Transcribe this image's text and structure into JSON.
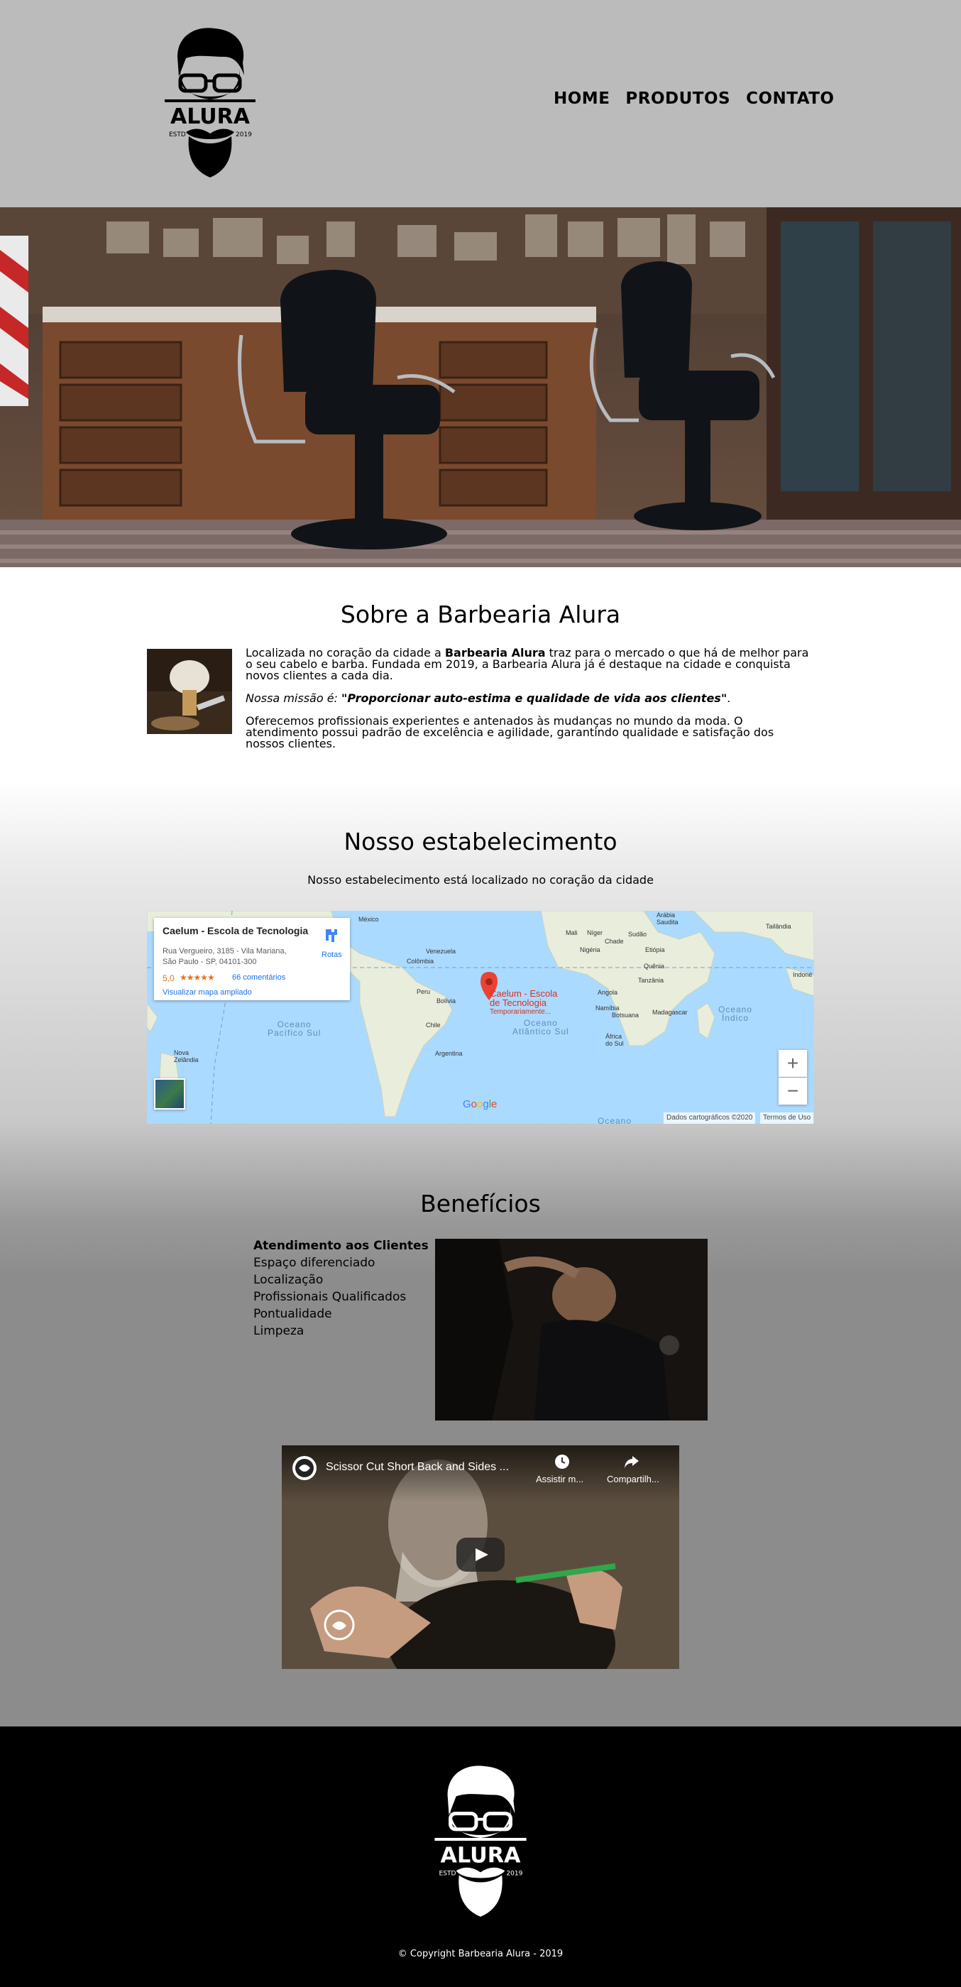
{
  "header": {
    "logo": {
      "brand": "ALURA",
      "estd": "ESTD",
      "year": "2019"
    },
    "nav": [
      "HOME",
      "PRODUTOS",
      "CONTATO"
    ]
  },
  "about": {
    "title": "Sobre a Barbearia Alura",
    "p1_before": "Localizada no coração da cidade a ",
    "p1_bold": "Barbearia Alura",
    "p1_after": " traz para o mercado o que há de melhor para o seu cabelo e barba. Fundada em 2019, a Barbearia Alura já é destaque na cidade e conquista novos clientes a cada dia.",
    "mission_label": "Nossa missão é: ",
    "mission_text": "\"Proporcionar auto-estima e qualidade de vida aos clientes\"",
    "mission_end": ".",
    "p3": "Oferecemos profissionais experientes e antenados às mudanças no mundo da moda. O atendimento possui padrão de excelência e agilidade, garantindo qualidade e satisfação dos nossos clientes."
  },
  "establishment": {
    "title": "Nosso estabelecimento",
    "subtitle": "Nosso estabelecimento está localizado no coração da cidade",
    "map": {
      "place_name": "Caelum - Escola de Tecnologia",
      "address_line1": "Rua Vergueiro, 3185 - Vila Mariana,",
      "address_line2": "São Paulo - SP, 04101-300",
      "rating": "5,0",
      "stars": "★★★★★",
      "reviews": "66 comentários",
      "larger_map": "Visualizar mapa ampliado",
      "directions": "Rotas",
      "pin_line1": "Caelum - Escola",
      "pin_line2": "de Tecnologia",
      "pin_status": "Temporariamente...",
      "zoom_in": "+",
      "zoom_out": "−",
      "attribution": "Dados cartográficos ©2020",
      "terms": "Termos de Uso",
      "google": [
        "G",
        "o",
        "o",
        "g",
        "l",
        "e"
      ],
      "google_colors": [
        "#4285f4",
        "#ea4335",
        "#fbbc05",
        "#4285f4",
        "#34a853",
        "#ea4335"
      ],
      "labels": {
        "mexico": "México",
        "venezuela": "Venezuela",
        "colombia": "Colômbia",
        "peru": "Peru",
        "bolivia": "Bolívia",
        "chile": "Chile",
        "argentina": "Argentina",
        "nz": "Nova\nZelândia",
        "mali": "Mali",
        "niger": "Níger",
        "sudan": "Sudão",
        "saudi": "Arábia\nSaudita",
        "thailand": "Tailândia",
        "nigeria": "Nigéria",
        "chad": "Chade",
        "ethiopia": "Etiópia",
        "kenya": "Quênia",
        "tanzania": "Tanzânia",
        "angola": "Angola",
        "namibia": "Namíbia",
        "botswana": "Botsuana",
        "madagascar": "Madagascar",
        "south_africa": "África\ndo Sul",
        "indonesia": "Indoné"
      },
      "oceans": {
        "pacific": "Oceano\nPacífico Sul",
        "atlantic": "Oceano\nAtlântico Sul",
        "indian": "Oceano\nÍndico",
        "bottom": "Oceano"
      }
    }
  },
  "benefits": {
    "title": "Benefícios",
    "items": [
      "Atendimento aos Clientes",
      "Espaço diferenciado",
      "Localização",
      "Profissionais Qualificados",
      "Pontualidade",
      "Limpeza"
    ]
  },
  "video": {
    "title": "Scissor Cut Short Back and Sides ...",
    "watch_later": "Assistir m...",
    "share": "Compartilh..."
  },
  "footer": {
    "copyright": "© Copyright Barbearia Alura - 2019"
  },
  "colors": {
    "header_bg": "#bbbbbb",
    "map_water": "#aadaff",
    "map_land": "#e8eddc",
    "pin": "#ea4335",
    "link": "#1a73e8",
    "footer_bg": "#000000"
  }
}
